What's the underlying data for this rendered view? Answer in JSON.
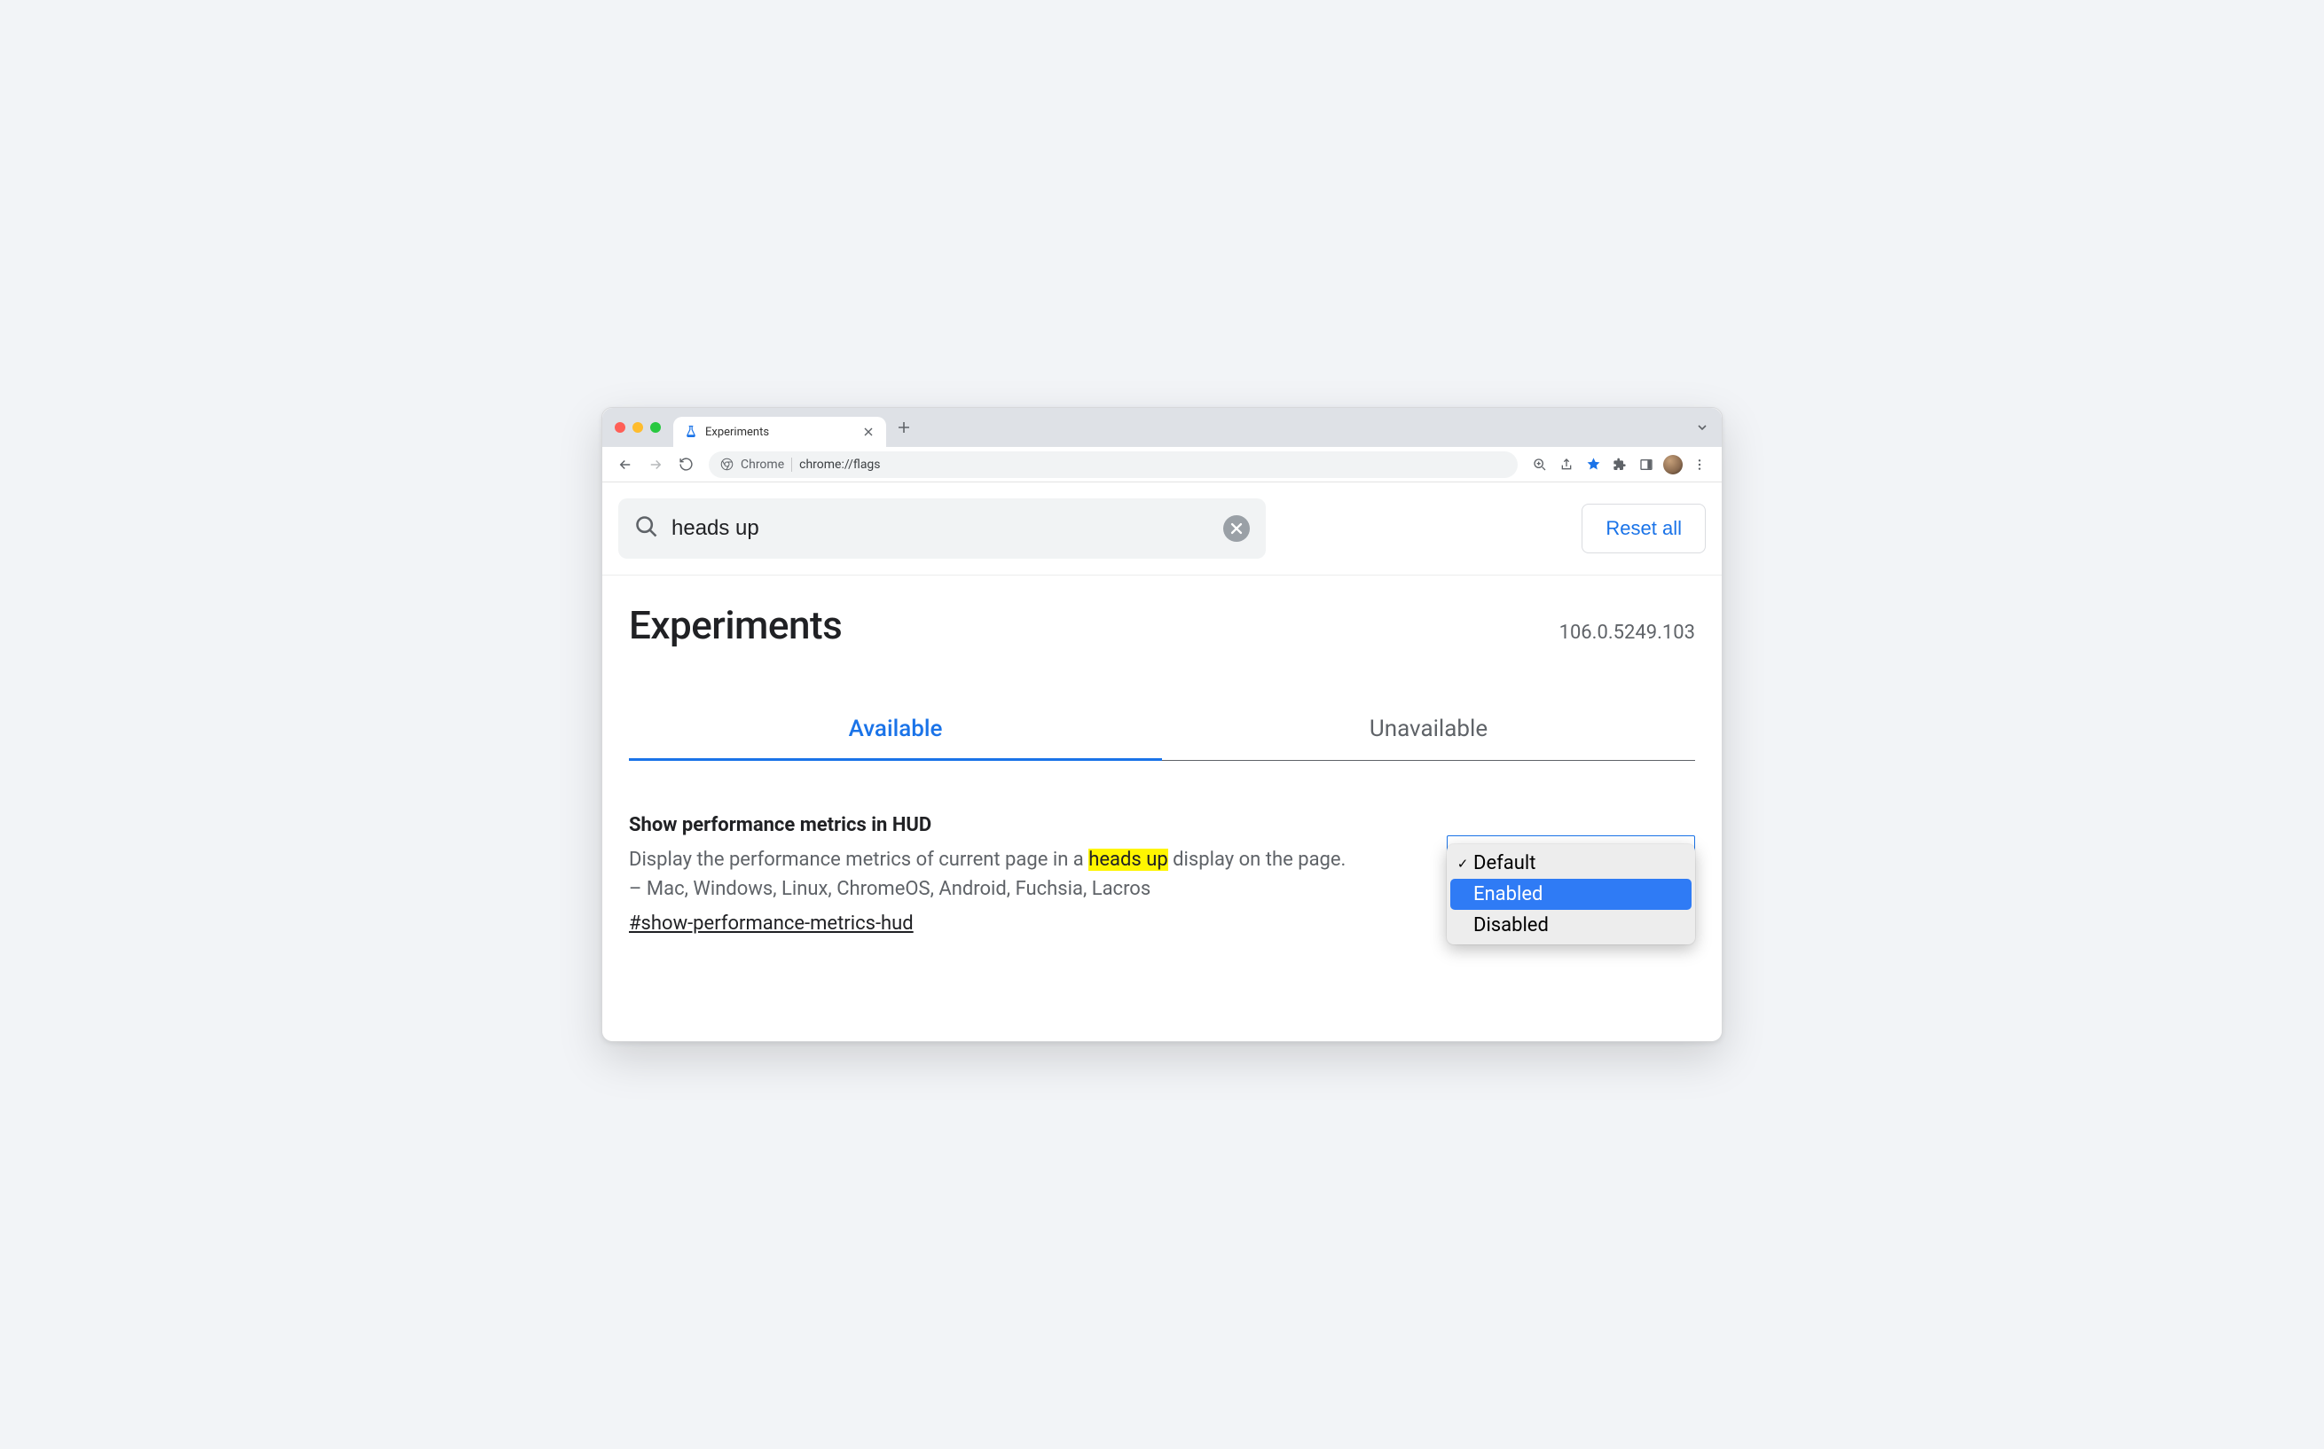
{
  "browser_tab": {
    "title": "Experiments"
  },
  "omnibox": {
    "chip": "Chrome",
    "url": "chrome://flags"
  },
  "search": {
    "value": "heads up"
  },
  "reset_button": "Reset all",
  "page": {
    "title": "Experiments",
    "version": "106.0.5249.103"
  },
  "tabs": {
    "available": "Available",
    "unavailable": "Unavailable"
  },
  "flag": {
    "title": "Show performance metrics in HUD",
    "desc_before": "Display the performance metrics of current page in a ",
    "desc_highlight": "heads up",
    "desc_after": " display on the page. – Mac, Windows, Linux, ChromeOS, Android, Fuchsia, Lacros",
    "hash": "#show-performance-metrics-hud"
  },
  "dropdown": {
    "options": {
      "default": "Default",
      "enabled": "Enabled",
      "disabled": "Disabled"
    }
  }
}
